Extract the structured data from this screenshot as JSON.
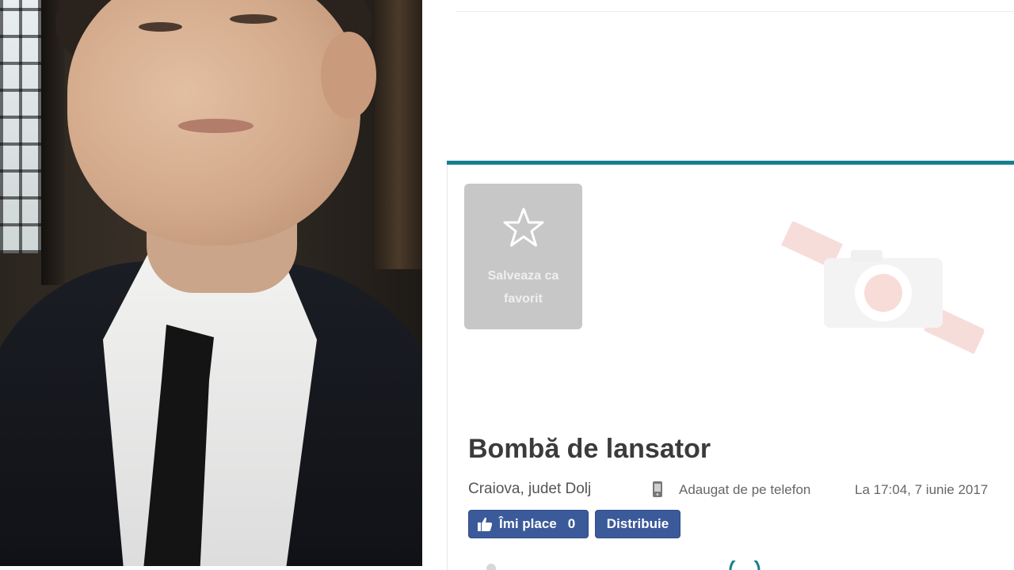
{
  "photo": {
    "alt": "man in dark suit and tie"
  },
  "listing": {
    "save_favorite_label": "Salveaza ca favorit",
    "title": "Bombă de lansator",
    "location": "Craiova, judet Dolj",
    "added_via": "Adaugat de pe telefon",
    "timestamp": "La 17:04, 7 iunie 2017"
  },
  "social": {
    "like_label": "Îmi place",
    "like_count": "0",
    "share_label": "Distribuie"
  },
  "colors": {
    "accent": "#157f8e",
    "facebook": "#3b5a9a",
    "favorite_bg": "#c7c7c7",
    "camera_placeholder": "#f3d6d2"
  },
  "icons": [
    "star-icon",
    "camera-placeholder-icon",
    "mobile-phone-icon",
    "thumbs-up-icon"
  ]
}
